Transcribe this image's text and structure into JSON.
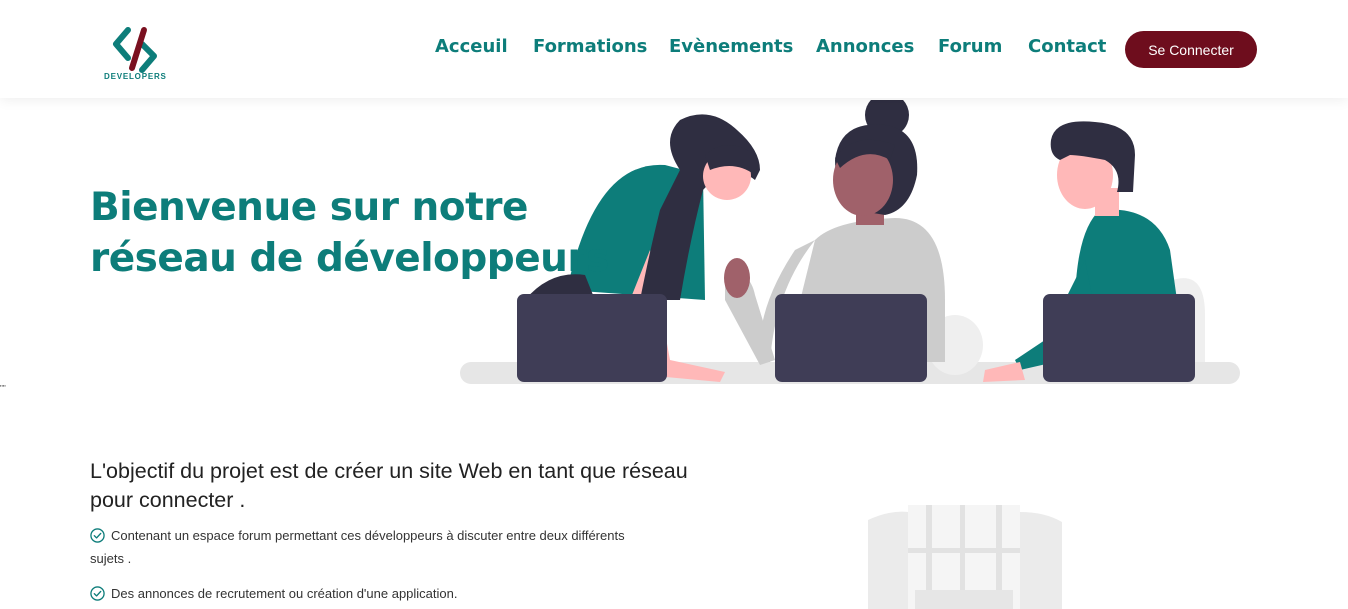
{
  "header": {
    "logo_text": "DEVELOPERS",
    "nav": [
      "Acceuil",
      "Formations",
      "Evènements",
      "Annonces",
      "Forum",
      "Contact"
    ],
    "login_button": "Se Connecter"
  },
  "hero": {
    "title_line1": "Bienvenue sur notre",
    "title_line2": "réseau de développeurs"
  },
  "stray_text": "\"\"",
  "objective": {
    "title": "L'objectif du projet est de créer un site Web en tant que réseau pour connecter .",
    "items": [
      "Contenant un espace forum permettant ces développeurs à discuter entre deux différents sujets .",
      "Des annonces de recrutement ou création d'une application."
    ]
  },
  "colors": {
    "brand_teal": "#0d7d7a",
    "button_maroon": "#6e0d1d",
    "laptop": "#3f3d56",
    "hair": "#2f2e41",
    "skin": "#ffb8b8"
  },
  "icons": [
    "logo-icon",
    "check-circle-icon",
    "team-illustration",
    "building-illustration"
  ]
}
